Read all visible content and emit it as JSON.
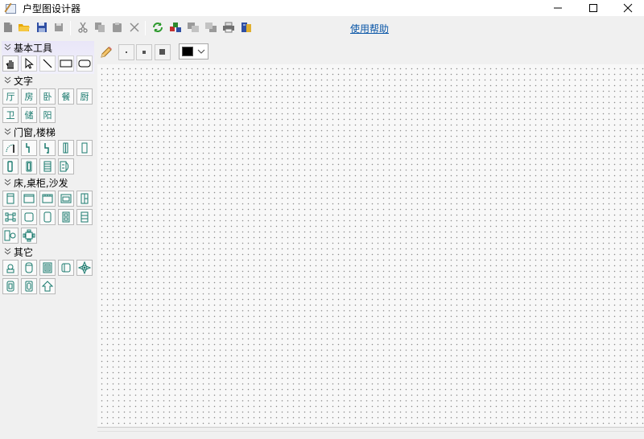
{
  "window": {
    "title": "户型图设计器",
    "controls": {
      "minimize": "minimize-icon",
      "maximize": "maximize-icon",
      "close": "close-icon"
    }
  },
  "toolbar": {
    "buttons": [
      "new-icon",
      "open-folder-icon",
      "save-icon",
      "save-as-icon",
      "cut-icon",
      "copy-icon",
      "paste-icon",
      "delete-icon",
      "refresh-icon",
      "layers-icon",
      "bring-front-icon",
      "send-back-icon",
      "print-icon",
      "export-icon"
    ],
    "help_link": "使用帮助"
  },
  "panel": {
    "groups": [
      {
        "title": "基本工具",
        "items": [
          "hand-icon",
          "pointer-icon",
          "line-icon",
          "rectangle-icon",
          "rounded-rectangle-icon"
        ]
      },
      {
        "title": "文字",
        "items": [
          "厅",
          "房",
          "卧",
          "餐",
          "厨",
          "卫",
          "储",
          "阳"
        ]
      },
      {
        "title": "门窗,楼梯",
        "items": [
          "arc-door-icon",
          "door-left-icon",
          "door-right-icon",
          "window-icon",
          "window-wide-icon",
          "window-narrow-icon",
          "window-double-icon",
          "stairs-icon",
          "door-frame-icon"
        ]
      },
      {
        "title": "床,桌柜,沙发",
        "items": [
          "bed-icon",
          "cabinet-icon",
          "wardrobe-icon",
          "sofa-icon",
          "shelf-icon",
          "dining-set-icon",
          "table-icon",
          "chair-icon",
          "double-bed-icon",
          "bookcase-icon",
          "desk-chair-icon",
          "round-table-icon"
        ]
      },
      {
        "title": "其它",
        "items": [
          "toilet-icon",
          "bathtub-icon",
          "shower-icon",
          "sink-icon",
          "compass-icon",
          "washer-icon",
          "fridge-icon",
          "house-icon"
        ]
      }
    ]
  },
  "drawbar": {
    "tools": [
      "pencil-icon",
      "line-width-small-icon",
      "line-width-medium-icon",
      "line-width-large-icon"
    ],
    "color": "#000000"
  },
  "colors": {
    "accent_link": "#0b57a8",
    "icon_teal": "#1a7a6e"
  }
}
